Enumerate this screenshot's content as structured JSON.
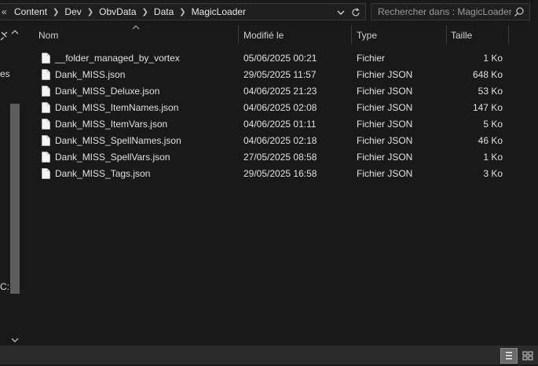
{
  "address": {
    "overflow": "«",
    "crumbs": [
      "Content",
      "Dev",
      "ObvData",
      "Data",
      "MagicLoader"
    ]
  },
  "search": {
    "placeholder": "Rechercher dans : MagicLoader"
  },
  "nav": {
    "partial_text_1": "es l",
    "partial_text_2": "C:)"
  },
  "columns": {
    "name": "Nom",
    "modified": "Modifié le",
    "type": "Type",
    "size": "Taille"
  },
  "files": [
    {
      "name": "__folder_managed_by_vortex",
      "modified": "05/06/2025 00:21",
      "type": "Fichier",
      "size": "1 Ko"
    },
    {
      "name": "Dank_MISS.json",
      "modified": "29/05/2025 11:57",
      "type": "Fichier JSON",
      "size": "648 Ko"
    },
    {
      "name": "Dank_MISS_Deluxe.json",
      "modified": "04/06/2025 21:23",
      "type": "Fichier JSON",
      "size": "53 Ko"
    },
    {
      "name": "Dank_MISS_ItemNames.json",
      "modified": "04/06/2025 02:08",
      "type": "Fichier JSON",
      "size": "147 Ko"
    },
    {
      "name": "Dank_MISS_ItemVars.json",
      "modified": "04/06/2025 01:11",
      "type": "Fichier JSON",
      "size": "5 Ko"
    },
    {
      "name": "Dank_MISS_SpellNames.json",
      "modified": "04/06/2025 02:18",
      "type": "Fichier JSON",
      "size": "46 Ko"
    },
    {
      "name": "Dank_MISS_SpellVars.json",
      "modified": "27/05/2025 08:58",
      "type": "Fichier JSON",
      "size": "1 Ko"
    },
    {
      "name": "Dank_MISS_Tags.json",
      "modified": "29/05/2025 16:58",
      "type": "Fichier JSON",
      "size": "3 Ko"
    }
  ],
  "icons": {
    "address_dropdown": "chevron-down-icon",
    "refresh": "refresh-icon",
    "search": "search-icon",
    "pin": "pin-icon",
    "file": "file-icon",
    "view_details": "details-view-icon",
    "view_tiles": "tiles-view-icon"
  },
  "colors": {
    "background": "#191919",
    "text": "#e0e0e0",
    "statusbar": "#2b2b2b",
    "scroll_thumb": "#5d5d5d"
  }
}
